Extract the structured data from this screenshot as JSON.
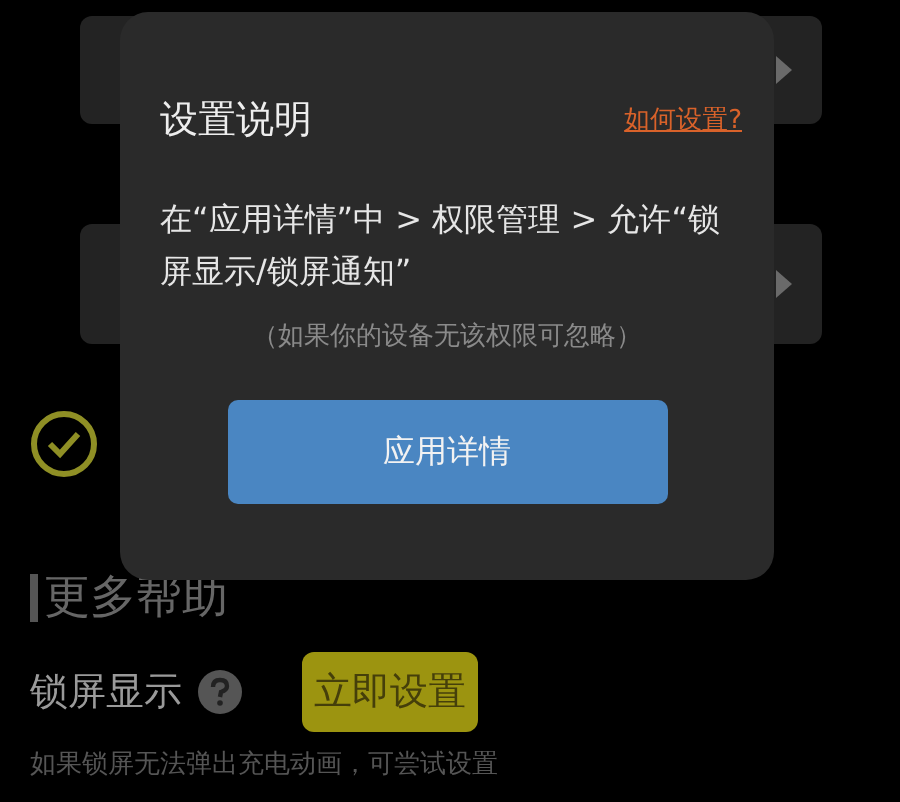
{
  "dialog": {
    "title": "设置说明",
    "help_link": "如何设置?",
    "instruction": "在“应用详情”中 > 权限管理 > 允许“锁屏显示/锁屏通知”",
    "note": "（如果你的设备无该权限可忽略）",
    "button": "应用详情"
  },
  "more_help": {
    "heading": "更多帮助",
    "label": "锁屏显示",
    "button": "立即设置",
    "description": "如果锁屏无法弹出充电动画，可尝试设置"
  }
}
